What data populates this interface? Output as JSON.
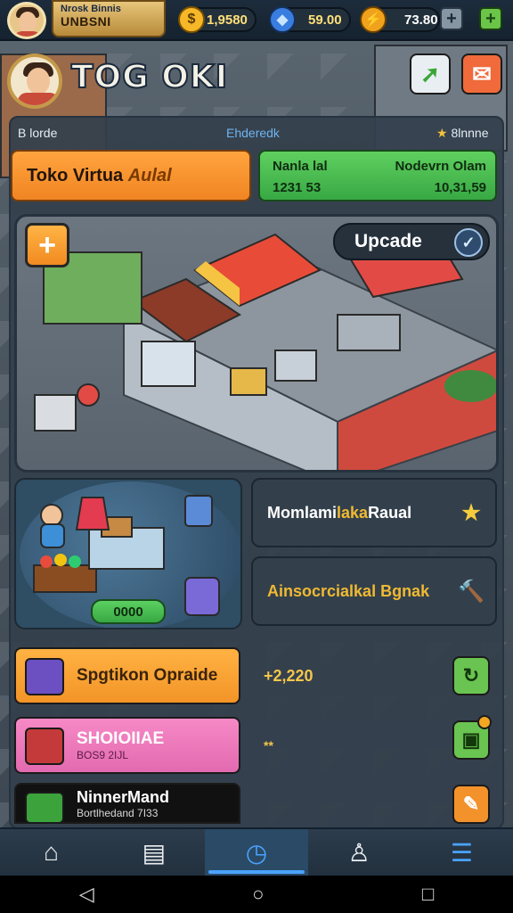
{
  "player": {
    "name": "Nrosk Binnis",
    "subtitle": "UNBSNI"
  },
  "resources": [
    {
      "name": "coins",
      "value": "1,9580",
      "icon": "$",
      "color": "#f6b728"
    },
    {
      "name": "gems",
      "value": "59.00",
      "icon": "◆",
      "color": "#3a7de0"
    },
    {
      "name": "energy",
      "value": "73.80",
      "icon": "⚡",
      "color": "#f0a21c"
    }
  ],
  "title": "TOG OKI",
  "header": {
    "left_label": "B lorde",
    "center_label": "Ehderedk",
    "right_label": "8lnnne",
    "right_star": "★"
  },
  "store_button": {
    "label_main": "Toko Virtua",
    "label_highlight": "Aulal"
  },
  "stats": {
    "left_label": "Nanla lal",
    "left_value": "1231 53",
    "right_label": "Nodevrn Olam",
    "right_value": "10,31,59"
  },
  "scene": {
    "add_glyph": "+",
    "upgrade_label": "Upcade",
    "check_glyph": "✓"
  },
  "circle_card": {
    "price": "0000"
  },
  "actions": [
    {
      "label_main": "Momlami",
      "label_highlight": "laka",
      "label_tail": " Raual",
      "icon": "★"
    },
    {
      "label_main": "Ainsocrcial",
      "label_highlight": " kal Bgnak",
      "label_tail": "",
      "icon": "🔨"
    }
  ],
  "rows": [
    {
      "title": "Spgtikon Opraide",
      "subtitle": "",
      "side_value": "+2,220"
    },
    {
      "title": "SHOIOIIAE",
      "subtitle": "BOS9 2IJL",
      "side_value": "**"
    },
    {
      "title": "NinnerMand",
      "subtitle": "Bortlhedand 7I33",
      "side_value": ""
    }
  ],
  "nav": [
    "home-icon",
    "shop-icon",
    "compass-icon",
    "ranking-icon",
    "menu-icon"
  ],
  "nav_glyphs": [
    "⌂",
    "▤",
    "◷",
    "♙",
    "☰"
  ],
  "android": {
    "back": "◁",
    "home": "○",
    "recent": "□"
  }
}
